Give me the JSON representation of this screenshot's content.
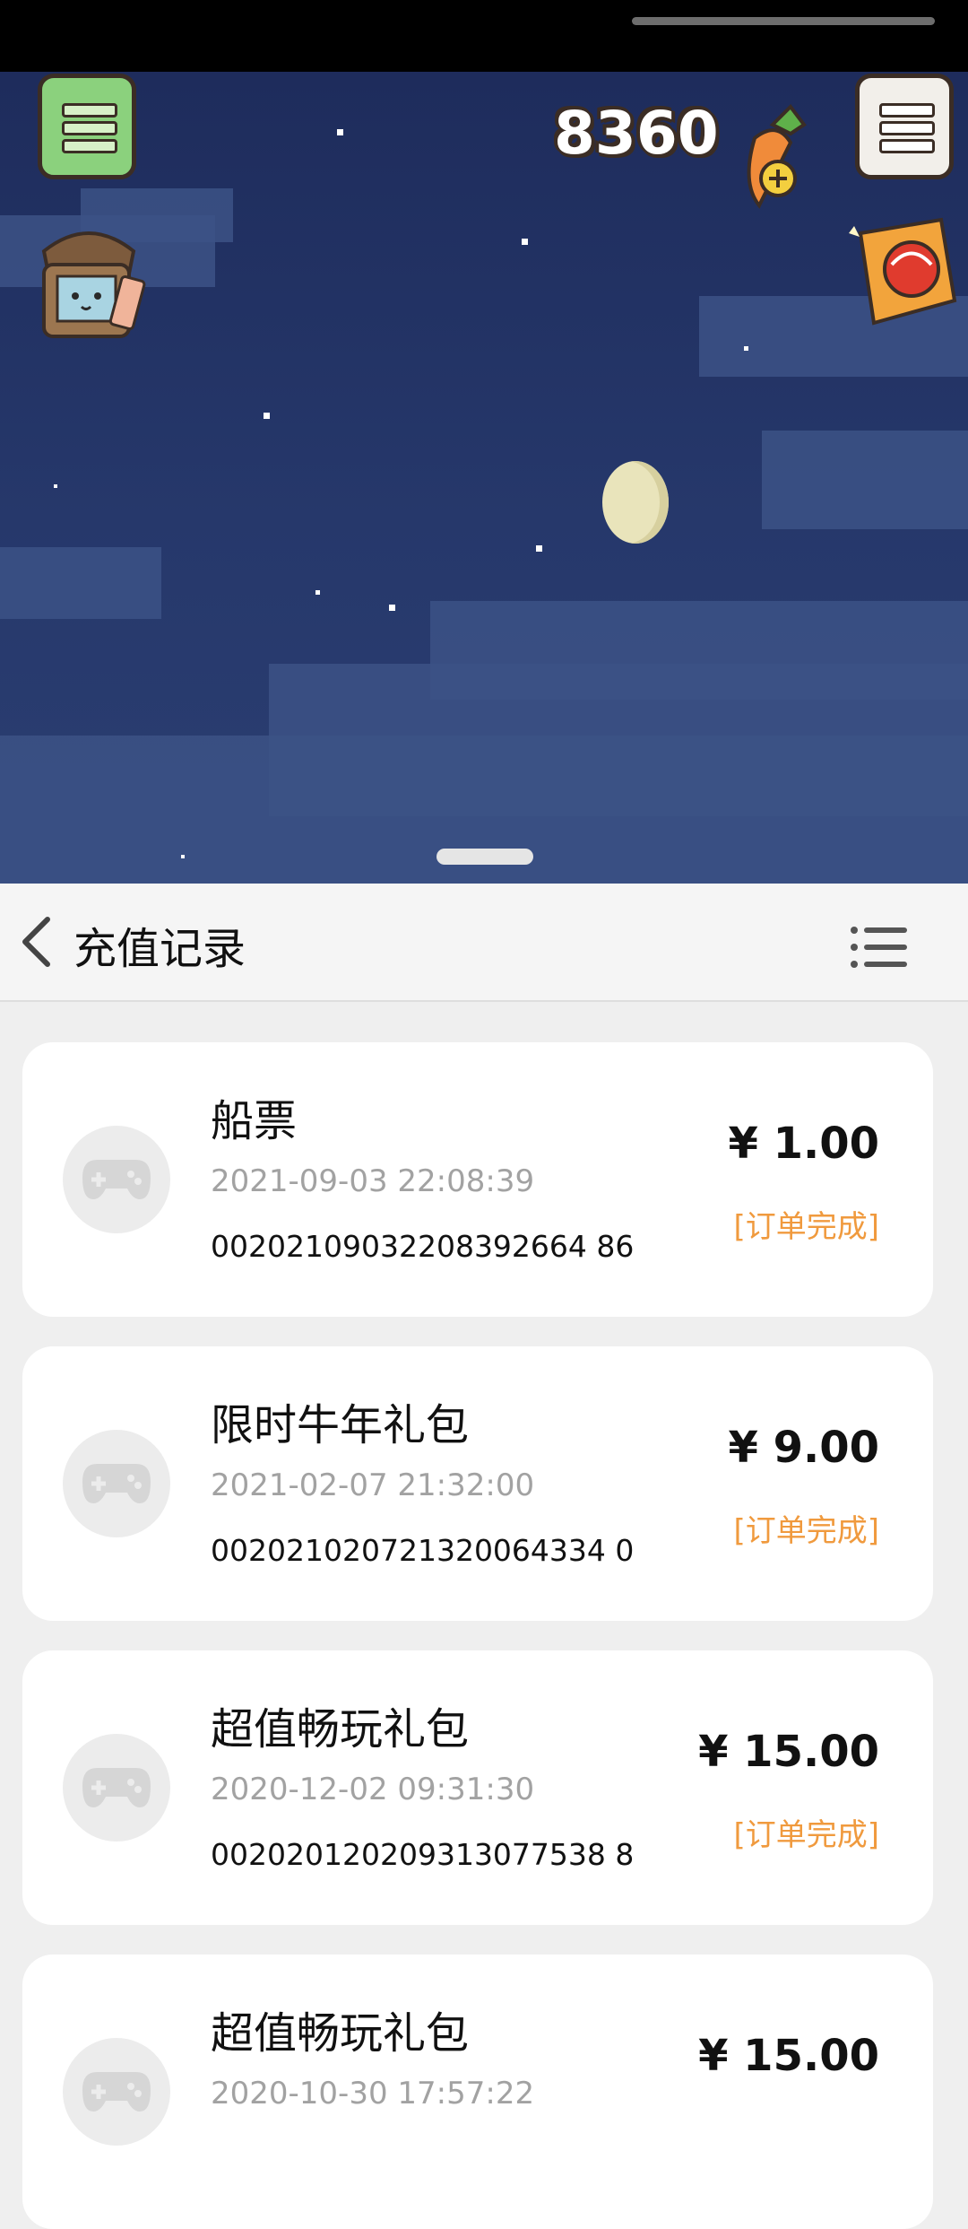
{
  "game": {
    "score": "8360",
    "icons": [
      "menu-icon",
      "carrot-plus-icon",
      "tv-character-icon",
      "gift-card-icon"
    ]
  },
  "header": {
    "title": "充值记录",
    "icons": [
      "chevron-left-icon",
      "list-icon"
    ]
  },
  "records": [
    {
      "title": "船票",
      "time": "2021-09-03 22:08:39",
      "order": "00202109032208392664 86",
      "price": "¥ 1.00",
      "status": "[订单完成]"
    },
    {
      "title": "限时牛年礼包",
      "time": "2021-02-07 21:32:00",
      "order": "002021020721320064334 0",
      "price": "¥ 9.00",
      "status": "[订单完成]"
    },
    {
      "title": "超值畅玩礼包",
      "time": "2020-12-02 09:31:30",
      "order": "002020120209313077538 8",
      "price": "¥ 15.00",
      "status": "[订单完成]"
    },
    {
      "title": "超值畅玩礼包",
      "time": "2020-10-30 17:57:22",
      "order": "",
      "price": "¥ 15.00",
      "status": ""
    }
  ],
  "colors": {
    "status": "#f09a3e",
    "sky": "#26386b",
    "header_bg": "#f5f5f5"
  }
}
